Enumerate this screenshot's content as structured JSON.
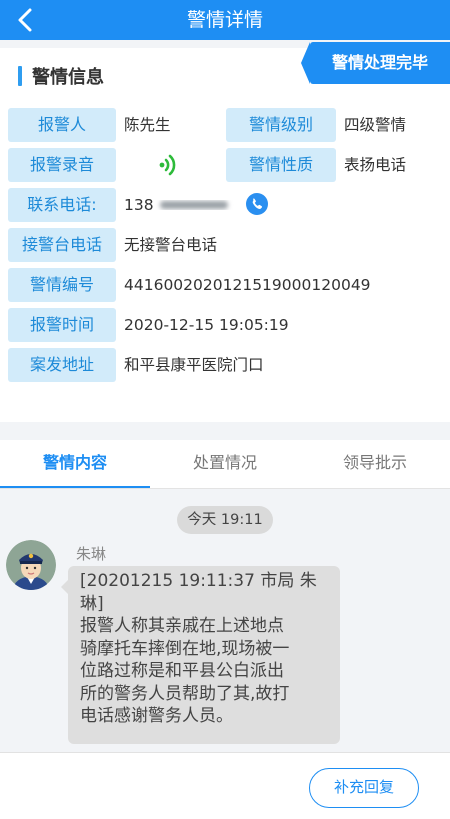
{
  "header": {
    "title": "警情详情",
    "back_icon": "chevron-left-icon"
  },
  "status_tag": "警情处理完毕",
  "section_title": "警情信息",
  "fields": {
    "reporter_label": "报警人",
    "reporter_value": "陈先生",
    "level_label": "警情级别",
    "level_value": "四级警情",
    "recording_label": "报警录音",
    "nature_label": "警情性质",
    "nature_value": "表扬电话",
    "phone_label": "联系电话:",
    "phone_value": "138",
    "desk_phone_label": "接警台电话",
    "desk_phone_value": "无接警台电话",
    "case_no_label": "警情编号",
    "case_no_value": "44160020201215190001200​49",
    "report_time_label": "报警时间",
    "report_time_value": "2020-12-15 19:05:19",
    "address_label": "案发地址",
    "address_value": "和平县康平医院门口"
  },
  "tabs": [
    {
      "label": "警情内容",
      "active": true
    },
    {
      "label": "处置情况",
      "active": false
    },
    {
      "label": "领导批示",
      "active": false
    }
  ],
  "message": {
    "time_badge": "今天 19:11",
    "sender": "朱琳",
    "lines": [
      "[20201215 19:11:37 市局 朱",
      "琳]",
      "报警人称其亲戚在上述地点",
      "骑摩托车摔倒在地,现场被一",
      "位路过称是和平县公白派出",
      "所的警务人员帮助了其,故打",
      "电话感谢警务人员。"
    ]
  },
  "reply_button": "补充回复",
  "colors": {
    "primary": "#1e8ef3",
    "label_bg": "#d2ebfa",
    "label_text": "#1d8ad8",
    "phone_icon": "#2a8ff0",
    "sound_icon": "#2dbb3a"
  }
}
